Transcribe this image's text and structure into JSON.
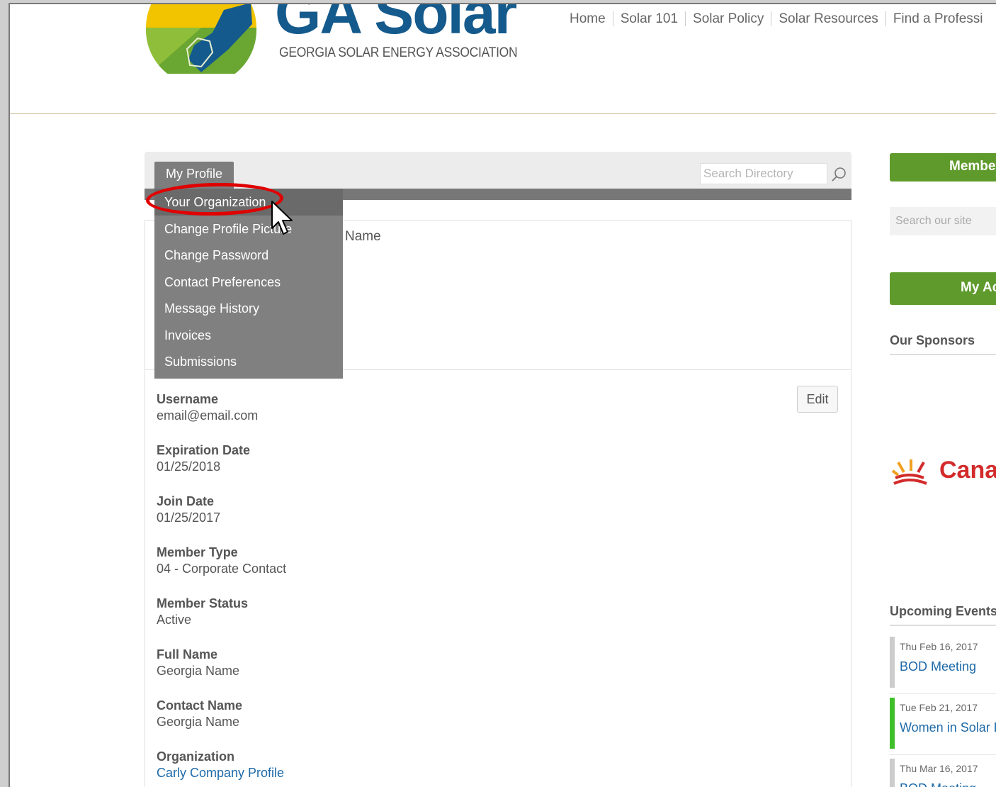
{
  "header": {
    "brand_title": "GA Solar",
    "brand_subtitle": "GEORGIA SOLAR ENERGY ASSOCIATION",
    "nav": [
      "Home",
      "Solar 101",
      "Solar Policy",
      "Solar Resources",
      "Find a Professi"
    ]
  },
  "profile_tabs": {
    "active_tab": "My Profile",
    "search_placeholder": "Search Directory"
  },
  "dropdown": {
    "items": [
      "Your Organization",
      "Change Profile Picture",
      "Change Password",
      "Contact Preferences",
      "Message History",
      "Invoices",
      "Submissions"
    ],
    "highlighted": "Your Organization"
  },
  "profile_header": {
    "name_label": "Name"
  },
  "profile": {
    "edit_label": "Edit",
    "fields": [
      {
        "label": "Username",
        "value": "email@email.com"
      },
      {
        "label": "Expiration Date",
        "value": "01/25/2018"
      },
      {
        "label": "Join Date",
        "value": "01/25/2017"
      },
      {
        "label": "Member Type",
        "value": "04 - Corporate Contact"
      },
      {
        "label": "Member Status",
        "value": "Active"
      },
      {
        "label": "Full Name",
        "value": "Georgia Name"
      },
      {
        "label": "Contact Name",
        "value": "Georgia Name"
      },
      {
        "label": "Organization",
        "value": "Carly Company Profile"
      }
    ]
  },
  "sidebar": {
    "member_button": "Membe",
    "search_placeholder": "Search our site",
    "my_account_button": "My Ac",
    "sponsors_heading": "Our Sponsors",
    "sponsor_name": "Cana",
    "events_heading": "Upcoming Events",
    "events": [
      {
        "date": "Thu Feb 16, 2017",
        "title": "BOD Meeting"
      },
      {
        "date": "Tue Feb 21, 2017",
        "title": "Women in Solar E"
      },
      {
        "date": "Thu Mar 16, 2017",
        "title": "BOD Meeting"
      }
    ]
  },
  "colors": {
    "brand_blue": "#145a8c",
    "accent_green": "#5f9a2c",
    "highlight_red": "#e00000",
    "dropdown_gray": "#808080"
  }
}
